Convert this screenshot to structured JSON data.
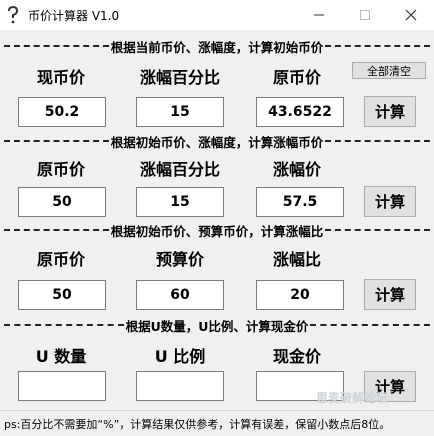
{
  "window": {
    "title": "币价计算器 V1.0",
    "controls": [
      "minimize-icon",
      "maximize-icon",
      "close-icon"
    ]
  },
  "clear_all_label": "全部清空",
  "sections": [
    {
      "header": "根据当前币价、涨幅度，计算初始币价",
      "labels": [
        "现币价",
        "涨幅百分比",
        "原币价"
      ],
      "values": [
        "50.2",
        "15",
        "43.6522"
      ],
      "button": "计算"
    },
    {
      "header": "根据初始币价、涨幅度，计算涨幅币价",
      "labels": [
        "原币价",
        "涨幅百分比",
        "涨幅价"
      ],
      "values": [
        "50",
        "15",
        "57.5"
      ],
      "button": "计算"
    },
    {
      "header": "根据初始币价、预算币价，计算涨幅比",
      "labels": [
        "原币价",
        "预算价",
        "涨幅比"
      ],
      "values": [
        "50",
        "60",
        "20"
      ],
      "button": "计算"
    },
    {
      "header": "根据U数量，U比例、计算现金价",
      "labels": [
        "U 数量",
        "U 比例",
        "现金价"
      ],
      "values": [
        "",
        "",
        ""
      ],
      "button": "计算"
    }
  ],
  "status_text": "ps:百分比不需要加“%”，计算结果仅供参考，计算有误差，保留小数点后8位。",
  "watermark": "恩麦破解论坛"
}
